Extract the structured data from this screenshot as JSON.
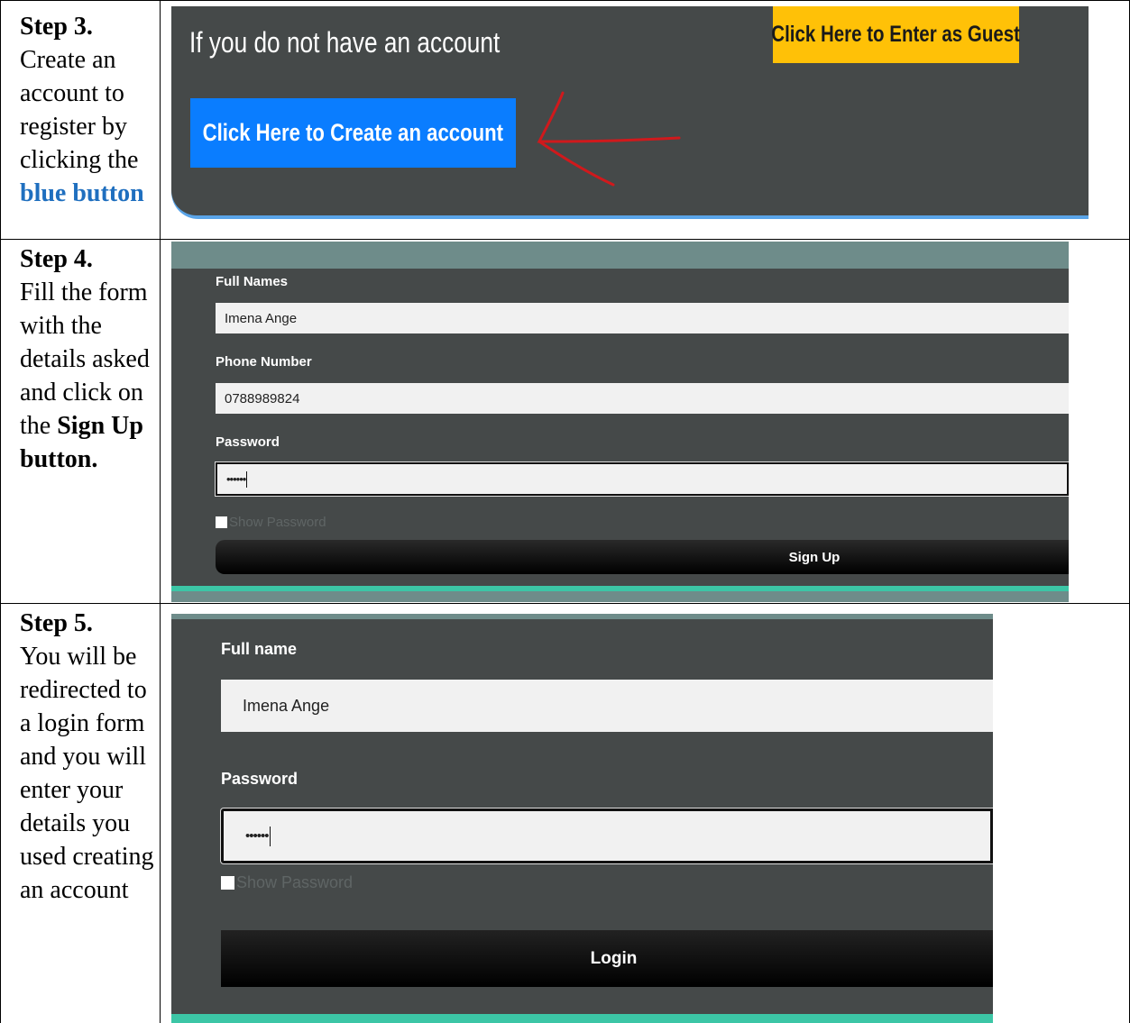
{
  "step3": {
    "heading": "Step 3.",
    "text_before": "Create an account to register by clicking the",
    "highlight": "blue button",
    "screenshot": {
      "headline": "If you do not have an account",
      "guest_button_label": "Click Here to Enter as Guest",
      "create_button_label": "Click Here to Create an account"
    }
  },
  "step4": {
    "heading": "Step 4.",
    "text_before": "Fill the form with the details asked and click on the",
    "emphasis": "Sign Up button.",
    "screenshot": {
      "full_names_label": "Full Names",
      "full_names_value": "Imena Ange",
      "phone_label": "Phone Number",
      "phone_value": "0788989824",
      "password_label": "Password",
      "password_value": "••••••",
      "show_password_label": "Show Password",
      "signup_button_label": "Sign Up"
    }
  },
  "step5": {
    "heading": "Step 5.",
    "text": "You will be redirected to a login form and you will enter your details you used creating an account",
    "screenshot": {
      "full_name_label": "Full name",
      "full_name_value": "Imena Ange",
      "password_label": "Password",
      "password_value": "••••••",
      "show_password_label": "Show Password",
      "login_button_label": "Login"
    }
  },
  "colors": {
    "panel": "#454949",
    "create_button": "#0a7dff",
    "guest_button": "#ffc107",
    "arrow": "#d0191c",
    "accent_teal": "#3cc6a6",
    "blue_text": "#1f6fbf"
  },
  "icons": [
    "red-arrow-annotation-icon",
    "checkbox-icon"
  ]
}
